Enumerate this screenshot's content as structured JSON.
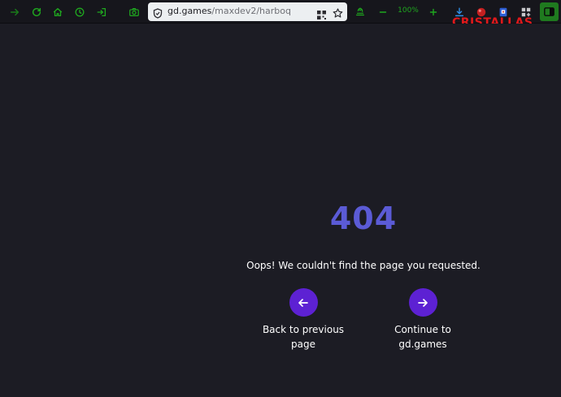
{
  "browser": {
    "url_domain": "gd.games",
    "url_path": "/maxdev2/harboq",
    "zoom": "100%",
    "overlay_text": "CRISTALLAS",
    "icons": {
      "forward": "forward-arrow-icon",
      "reload": "reload-icon",
      "home": "home-icon",
      "history": "clock-icon",
      "login": "login-icon",
      "screenshot": "camera-icon",
      "security": "shield-icon",
      "qr": "qr-code-icon",
      "bookmark": "star-icon",
      "reader": "reader-mode-icon",
      "zoom_out": "minus-icon",
      "zoom_in": "plus-icon",
      "downloads": "download-icon",
      "extensions": [
        "red-ball-extension-icon",
        "blue-badge-extension-icon",
        "puzzle-extensions-icon"
      ],
      "sidebar": "sidebar-toggle-icon"
    },
    "accent_color": "#1fa81f"
  },
  "page": {
    "error_code": "404",
    "message": "Oops! We couldn't find the page you requested.",
    "back_label_line1": "Back to previous",
    "back_label_line2": "page",
    "continue_label_line1": "Continue to",
    "continue_label_line2": "gd.games",
    "colors": {
      "background": "#1c1c24",
      "error_code": "#5b5bd6",
      "button": "#5d21d3"
    }
  }
}
